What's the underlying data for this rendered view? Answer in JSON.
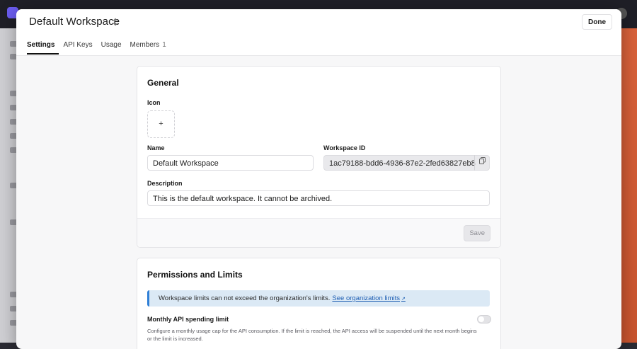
{
  "header": {
    "workspace_name": "Default Workspace",
    "done_label": "Done"
  },
  "tabs": [
    {
      "label": "Settings",
      "active": true
    },
    {
      "label": "API Keys"
    },
    {
      "label": "Usage"
    },
    {
      "label": "Members",
      "count": "1"
    }
  ],
  "general": {
    "title": "General",
    "icon_label": "Icon",
    "icon_add": "+",
    "name_label": "Name",
    "name_value": "Default Workspace",
    "workspace_id_label": "Workspace ID",
    "workspace_id_value": "1ac79188-bdd6-4936-87e2-2fed63827eb8",
    "description_label": "Description",
    "description_value": "This is the default workspace. It cannot be archived.",
    "save_label": "Save"
  },
  "permissions": {
    "title": "Permissions and Limits",
    "notice_text": "Workspace limits can not exceed the organization's limits.",
    "notice_link": "See organization limits",
    "spending_limit_label": "Monthly API spending limit",
    "spending_limit_enabled": false,
    "spending_limit_desc": "Configure a monthly usage cap for the API consumption. If the limit is reached, the API access will be suspended until the next month begins or the limit is increased."
  },
  "icons": [
    "chevron-up-down-icon",
    "copy-icon",
    "external-link-icon"
  ],
  "colors": {
    "notice_bg": "#dbe9f5",
    "notice_accent": "#2f7fd6",
    "background_accent": "#d9623b"
  }
}
